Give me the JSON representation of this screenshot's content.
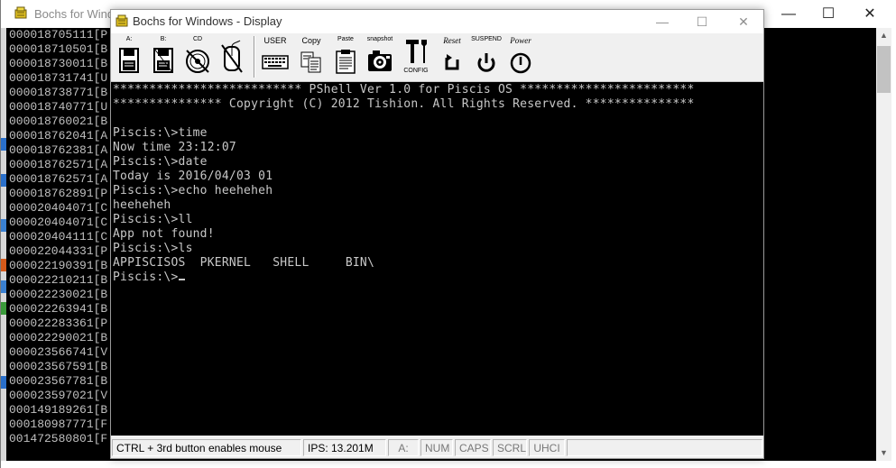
{
  "background_window": {
    "title": "Bochs for Windo",
    "controls": {
      "minimize": "—",
      "maximize": "☐",
      "close": "✕"
    },
    "log_lines": [
      "000018705111[P",
      "000018710501[B",
      "000018730011[B",
      "000018731741[U",
      "000018738771[B",
      "000018740771[U",
      "000018760021[B",
      "000018762041[A",
      "000018762381[A",
      "000018762571[A",
      "000018762571[A",
      "000018762891[P",
      "000020404071[C",
      "000020404071[C",
      "000020404111[C",
      "000022044331[P",
      "000022190391[B",
      "000022210211[B",
      "000022230021[B",
      "000022263941[B",
      "000022283361[P",
      "000022290021[B",
      "000023566741[V",
      "000023567591[B",
      "000023567781[B",
      "000023597021[V",
      "000149189261[B",
      "000180987771[F",
      "001472580801[F"
    ]
  },
  "window": {
    "title": "Bochs for Windows - Display",
    "controls": {
      "minimize": "—",
      "maximize": "☐",
      "close": "✕"
    }
  },
  "toolbar": {
    "floppy_a": "A:",
    "floppy_b": "B:",
    "cdrom": "CD",
    "user": "USER",
    "copy": "Copy",
    "paste": "Paste",
    "snapshot": "snapshot",
    "config": "CONFIG",
    "reset": "Reset",
    "suspend": "SUSPEND",
    "power": "Power"
  },
  "screen": {
    "lines": [
      "************************** PShell Ver 1.0 for Piscis OS ************************",
      "*************** Copyright (C) 2012 Tishion. All Rights Reserved. ***************",
      "",
      "Piscis:\\>time",
      "Now time 23:12:07",
      "Piscis:\\>date",
      "Today is 2016/04/03 01",
      "Piscis:\\>echo heeheheh",
      "heeheheh",
      "Piscis:\\>ll",
      "App not found!",
      "Piscis:\\>ls",
      "APPISCISOS  PKERNEL   SHELL     BIN\\"
    ],
    "prompt": "Piscis:\\>"
  },
  "statusbar": {
    "hint": "CTRL + 3rd button enables mouse",
    "ips": "IPS: 13.201M",
    "drive": "A:",
    "num": "NUM",
    "caps": "CAPS",
    "scrl": "SCRL",
    "uhci": "UHCI"
  }
}
